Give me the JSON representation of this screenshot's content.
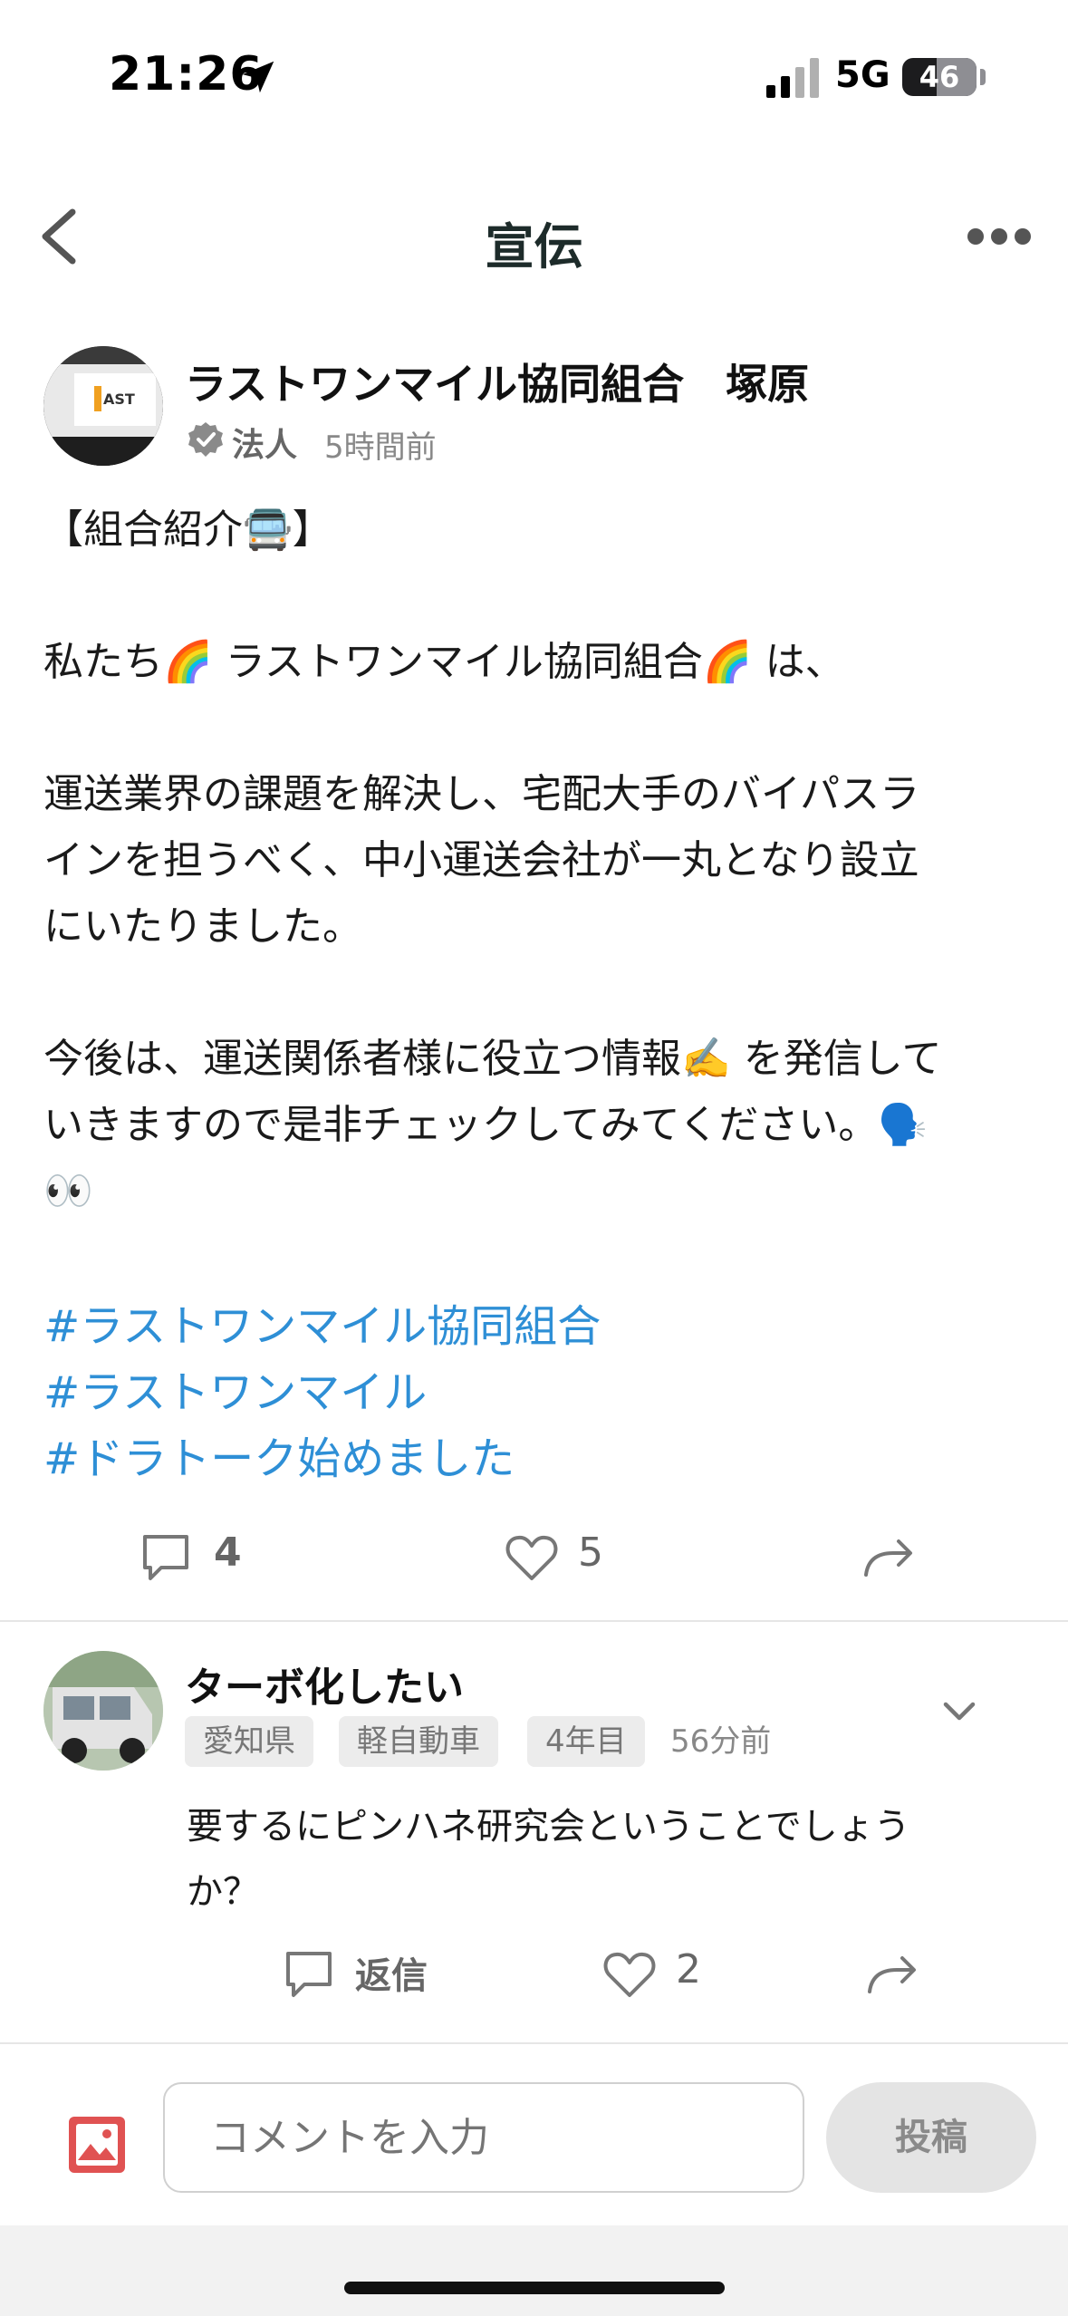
{
  "status_bar": {
    "time": "21:26",
    "network": "5G",
    "battery": "46"
  },
  "nav": {
    "title": "宣伝"
  },
  "post": {
    "author": "ラストワンマイル協同組合　塚原",
    "account_type": "法人",
    "time": "5時間前",
    "body_lines": [
      "【組合紹介🚍】",
      "",
      "私たち🌈 ラストワンマイル協同組合🌈 は、",
      "",
      "運送業界の課題を解決し、宅配大手のバイパスラ",
      "インを担うべく、中小運送会社が一丸となり設立",
      "にいたりました。",
      "",
      "今後は、運送関係者様に役立つ情報✍️ を発信して",
      "いきますので是非チェックしてみてください。🗣️",
      "👀"
    ],
    "hashtags": [
      "#ラストワンマイル協同組合",
      "#ラストワンマイル",
      "#ドラトーク始めました"
    ],
    "comments_count": "4",
    "likes_count": "5"
  },
  "comment": {
    "author": "ターボ化したい",
    "tags": [
      "愛知県",
      "軽自動車",
      "4年目"
    ],
    "time": "56分前",
    "text_lines": [
      "要するにピンハネ研究会ということでしょう",
      "か？"
    ],
    "reply_label": "返信",
    "likes_count": "2"
  },
  "input": {
    "placeholder": "コメントを入力",
    "post_label": "投稿"
  },
  "colors": {
    "hashtag": "#2e8fd6",
    "image_icon": "#e05252"
  },
  "icons": [
    "location-arrow-icon",
    "signal-icon",
    "battery-icon",
    "back-chevron-icon",
    "more-icon",
    "verified-icon",
    "comment-icon",
    "heart-icon",
    "share-icon",
    "chevron-down-icon",
    "image-icon"
  ]
}
